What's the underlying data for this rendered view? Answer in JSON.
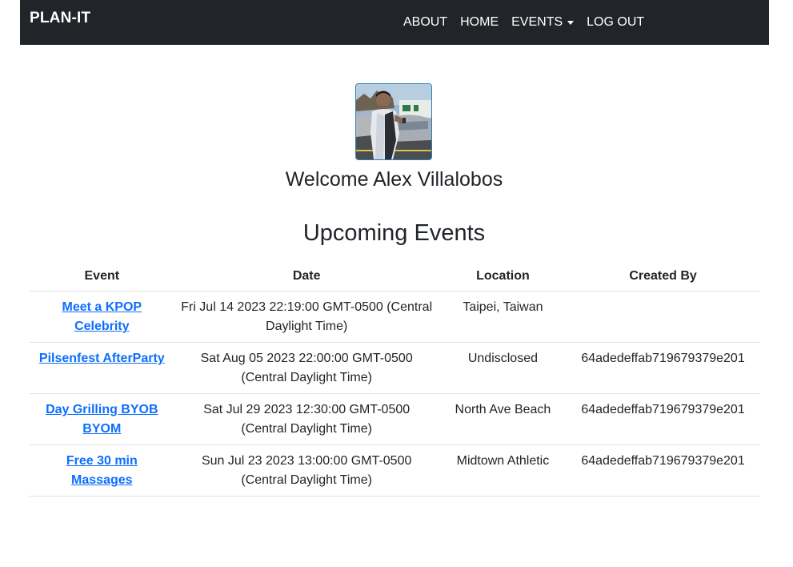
{
  "navbar": {
    "brand": "PLAN-IT",
    "links": {
      "about": "ABOUT",
      "home": "HOME",
      "events": "EVENTS",
      "logout": "LOG OUT"
    }
  },
  "profile": {
    "welcome": "Welcome Alex Villalobos"
  },
  "events_section": {
    "title": "Upcoming Events",
    "columns": [
      "Event",
      "Date",
      "Location",
      "Created By"
    ],
    "rows": [
      {
        "event": "Meet a KPOP Celebrity",
        "date": "Fri Jul 14 2023 22:19:00 GMT-0500 (Central Daylight Time)",
        "location": "Taipei, Taiwan",
        "created_by": ""
      },
      {
        "event": "Pilsenfest AfterParty",
        "date": "Sat Aug 05 2023 22:00:00 GMT-0500 (Central Daylight Time)",
        "location": "Undisclosed",
        "created_by": "64adedeffab719679379e201"
      },
      {
        "event": "Day Grilling BYOB BYOM",
        "date": "Sat Jul 29 2023 12:30:00 GMT-0500 (Central Daylight Time)",
        "location": "North Ave Beach",
        "created_by": "64adedeffab719679379e201"
      },
      {
        "event": "Free 30 min Massages",
        "date": "Sun Jul 23 2023 13:00:00 GMT-0500 (Central Daylight Time)",
        "location": "Midtown Athletic",
        "created_by": "64adedeffab719679379e201"
      }
    ]
  },
  "colors": {
    "navbar_bg": "#212529",
    "link": "#0d6efd",
    "text": "#212529",
    "avatar_border": "#2a7fb8"
  }
}
